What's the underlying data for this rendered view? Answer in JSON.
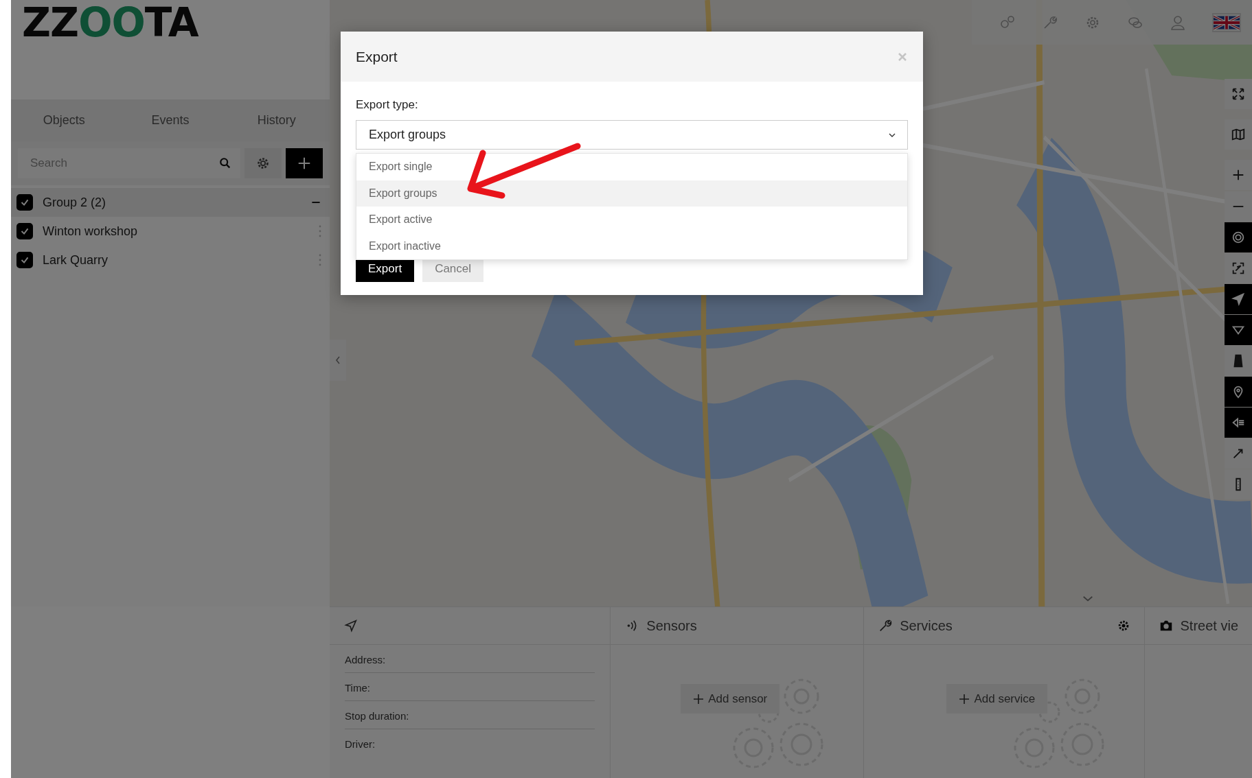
{
  "logo": {
    "parts": [
      {
        "text": "ZZ",
        "accent": false
      },
      {
        "text": "OO",
        "accent": true
      },
      {
        "text": "TA",
        "accent": false
      }
    ]
  },
  "sidebar": {
    "tabs": [
      {
        "label": "Objects"
      },
      {
        "label": "Events"
      },
      {
        "label": "History"
      }
    ],
    "search": {
      "placeholder": "Search"
    },
    "groups": [
      {
        "name": "Group 2 (2)",
        "checked": true,
        "expanded": true,
        "children": [
          {
            "name": "Winton workshop",
            "checked": true
          },
          {
            "name": "Lark Quarry",
            "checked": true
          }
        ]
      }
    ]
  },
  "map_toolbar": [
    {
      "kind": "fullscreen",
      "active": false
    },
    {
      "kind": "map",
      "active": false
    },
    {
      "kind": "zoom-in",
      "active": false
    },
    {
      "kind": "zoom-out",
      "active": false
    },
    {
      "kind": "cluster",
      "active": true
    },
    {
      "kind": "fit",
      "active": false
    },
    {
      "kind": "navigate",
      "active": true
    },
    {
      "kind": "polygon",
      "active": true
    },
    {
      "kind": "road",
      "active": false
    },
    {
      "kind": "marker",
      "active": true
    },
    {
      "kind": "list",
      "active": true
    },
    {
      "kind": "route",
      "active": false
    },
    {
      "kind": "traffic",
      "active": false
    }
  ],
  "bottom_panels": [
    {
      "kind": "location",
      "fields": [
        "Address:",
        "Time:",
        "Stop duration:",
        "Driver:"
      ]
    },
    {
      "kind": "sensors",
      "title": "Sensors",
      "action": "Add sensor"
    },
    {
      "kind": "services",
      "title": "Services",
      "action": "Add service"
    },
    {
      "kind": "streetview",
      "title": "Street vie"
    }
  ],
  "modal": {
    "title": "Export",
    "label": "Export type:",
    "value": "Export groups",
    "options": [
      {
        "label": "Export single",
        "selected": false
      },
      {
        "label": "Export groups",
        "selected": true
      },
      {
        "label": "Export active",
        "selected": false
      },
      {
        "label": "Export inactive",
        "selected": false
      }
    ],
    "buttons": [
      {
        "label": "Export",
        "kind": "primary"
      },
      {
        "label": "Cancel",
        "kind": "secondary"
      }
    ]
  }
}
